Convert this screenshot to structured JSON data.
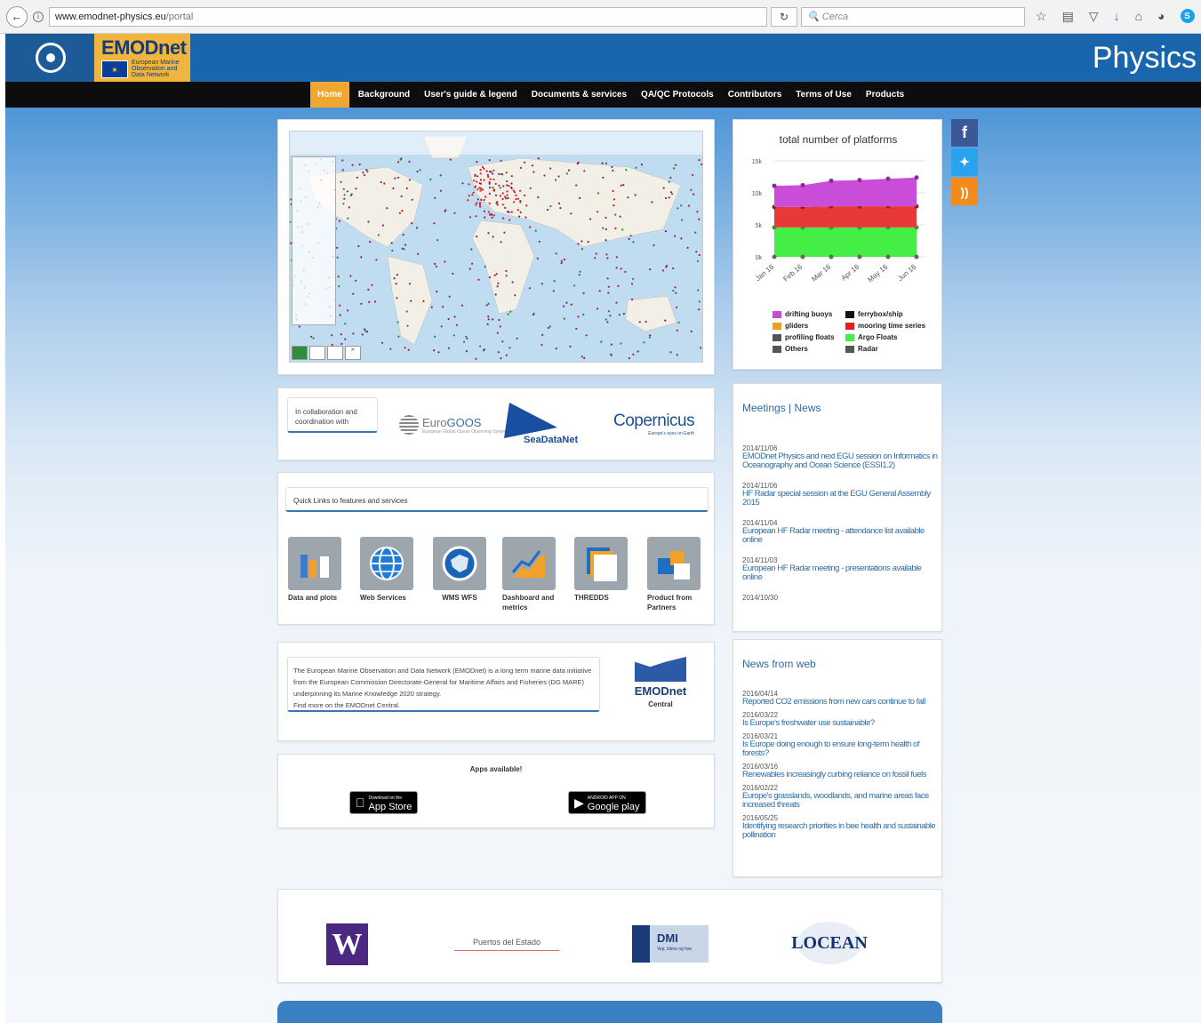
{
  "browser": {
    "url_host": "www.emodnet-physics.eu",
    "url_path": "/portal",
    "search_placeholder": "Cerca"
  },
  "header": {
    "logo_title": "EMODnet",
    "logo_sub1": "European Marine",
    "logo_sub2": "Observation and",
    "logo_sub3": "Data Network",
    "section": "Physics"
  },
  "nav": {
    "items": [
      "Home",
      "Background",
      "User's guide & legend",
      "Documents & services",
      "QA/QC Protocols",
      "Contributors",
      "Terms of Use",
      "Products"
    ]
  },
  "chart_data": {
    "type": "area",
    "title": "total number of platforms",
    "categories": [
      "Jan 16",
      "Feb 16",
      "Mar 16",
      "Apr 16",
      "May 16",
      "Jun 16"
    ],
    "y_ticks": [
      "0k",
      "5k",
      "10k",
      "15k"
    ],
    "ylim": [
      0,
      15000
    ],
    "stacked": true,
    "series": [
      {
        "name": "Argo Floats",
        "color": "#44ee44",
        "values": [
          4600,
          4600,
          4600,
          4600,
          4600,
          4600
        ]
      },
      {
        "name": "mooring time series",
        "color": "#e83838",
        "values": [
          3200,
          3200,
          3300,
          3300,
          3300,
          3300
        ]
      },
      {
        "name": "drifting buoys",
        "color": "#c94dd8",
        "values": [
          3300,
          3400,
          4000,
          4100,
          4300,
          4500
        ]
      }
    ],
    "legend": [
      [
        {
          "name": "drifting buoys",
          "color": "#c94dd8"
        },
        {
          "name": "ferrybox/ship",
          "color": "#111111"
        }
      ],
      [
        {
          "name": "gliders",
          "color": "#f0a020"
        },
        {
          "name": "mooring time series",
          "color": "#e01f1f"
        }
      ],
      [
        {
          "name": "profiling floats",
          "color": "#555555"
        },
        {
          "name": "Argo Floats",
          "color": "#44ee44"
        }
      ],
      [
        {
          "name": "Others",
          "color": "#555555"
        },
        {
          "name": "Radar",
          "color": "#555555"
        }
      ]
    ],
    "legend_placement": "bottom"
  },
  "collab": {
    "text": "In collaboration and coordination with",
    "eurogoos_a": "Euro",
    "eurogoos_b": "GOOS",
    "eurogoos_tag": "European Global Ocean Observing System",
    "seadatanet": "SeaDataNet",
    "copernicus": "opernicus",
    "copernicus_tag": "Europe's eyes on Earth"
  },
  "quick": {
    "title": "Quick Links to features and services",
    "links": [
      {
        "label": "Data and plots",
        "icon": "bar-chart-icon"
      },
      {
        "label": "Web Services",
        "icon": "globe-icon"
      },
      {
        "label": "WMS WFS",
        "icon": "europe-map-icon"
      },
      {
        "label": "Dashboard and metrics",
        "icon": "dashboard-chart-icon"
      },
      {
        "label": "THREDDS",
        "icon": "stacked-pages-icon"
      },
      {
        "label": "Product from Partners",
        "icon": "cubes-icon"
      }
    ]
  },
  "about": {
    "text": "The European Marine Observation and Data Network (EMODnet) is a long term marine data initiative from the European Commission Directorate-General for Maritime Affairs and Fisheries (DG MARE) underpinning its Marine Knowledge 2020 strategy.",
    "link": "Find more on the EMODnet Central.",
    "logo_title": "EMODnet",
    "logo_caption": "Central"
  },
  "apps": {
    "title": "Apps available!",
    "appstore_small": "Download on the",
    "appstore": "App Store",
    "google_small": "ANDROID APP ON",
    "google": "Google play"
  },
  "meetings": {
    "title": "Meetings | News",
    "items": [
      {
        "date": "2014/11/06",
        "text": "EMODnet Physics and next EGU session on Informatics in Oceanography and Ocean Science (ESSI1.2)"
      },
      {
        "date": "2014/11/06",
        "text": "HF Radar special session at the EGU General Assembly 2015"
      },
      {
        "date": "2014/11/04",
        "text": "European HF Radar meeting - attendance list available online"
      },
      {
        "date": "2014/11/03",
        "text": "European HF Radar meeting - presentations available online"
      },
      {
        "date": "2014/10/30",
        "text": ""
      }
    ]
  },
  "news": {
    "title": "News from web",
    "items": [
      {
        "date": "2016/04/14",
        "text": "Reported CO2 emissions from new cars continue to fall"
      },
      {
        "date": "2016/03/22",
        "text": "Is Europe's freshwater use sustainable?"
      },
      {
        "date": "2016/03/21",
        "text": "Is Europe doing enough to ensure long-term health of forests?"
      },
      {
        "date": "2016/03/16",
        "text": "Renewables increasingly curbing reliance on fossil fuels"
      },
      {
        "date": "2016/02/22",
        "text": "Europe's grasslands, woodlands, and marine areas face increased threats"
      },
      {
        "date": "2016/05/25",
        "text": "Identifying research priorities in bee health and sustainable pollination"
      }
    ]
  },
  "partners": {
    "uw": "W",
    "puertos": "Puertos del Estado",
    "dmi": "DMI",
    "dmi_tag": "Vejr, klima og hav",
    "locean": "LOCEAN"
  },
  "social": {
    "facebook": "f",
    "twitter": "t",
    "rss": "rss"
  }
}
